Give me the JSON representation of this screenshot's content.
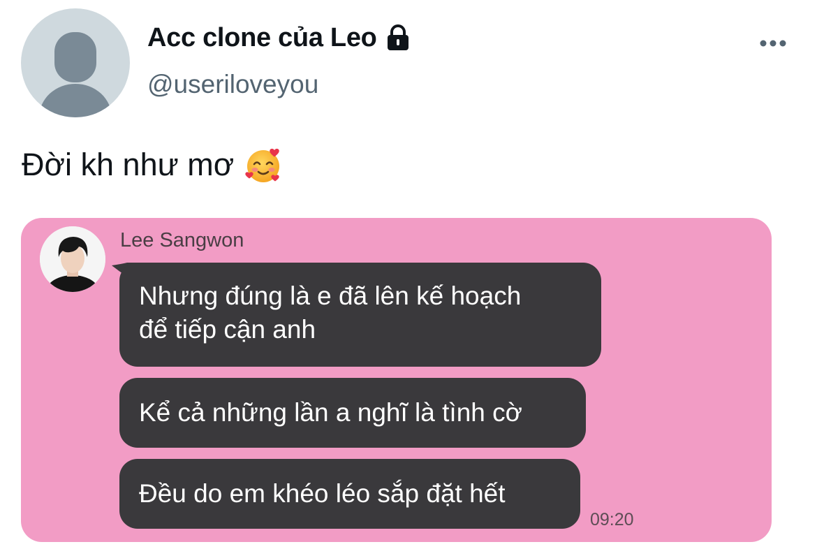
{
  "tweet": {
    "display_name": "Acc clone của Leo",
    "username": "@useriloveyou",
    "text": "Đời kh như mơ",
    "emoji": "smiling-face-with-hearts",
    "locked_icon": "lock-icon",
    "more_icon": "more-horizontal-icon"
  },
  "chat": {
    "background_color": "#f29cc5",
    "bubble_color": "#3a393c",
    "sender_name": "Lee Sangwon",
    "messages": [
      {
        "lines": [
          "Nhưng đúng là e đã lên kế hoạch",
          "để tiếp cận anh"
        ]
      },
      {
        "lines": [
          "Kể cả những lần a nghĩ là tình cờ"
        ]
      },
      {
        "lines": [
          "Đều do em khéo léo sắp đặt hết"
        ]
      }
    ],
    "time": "09:20"
  }
}
